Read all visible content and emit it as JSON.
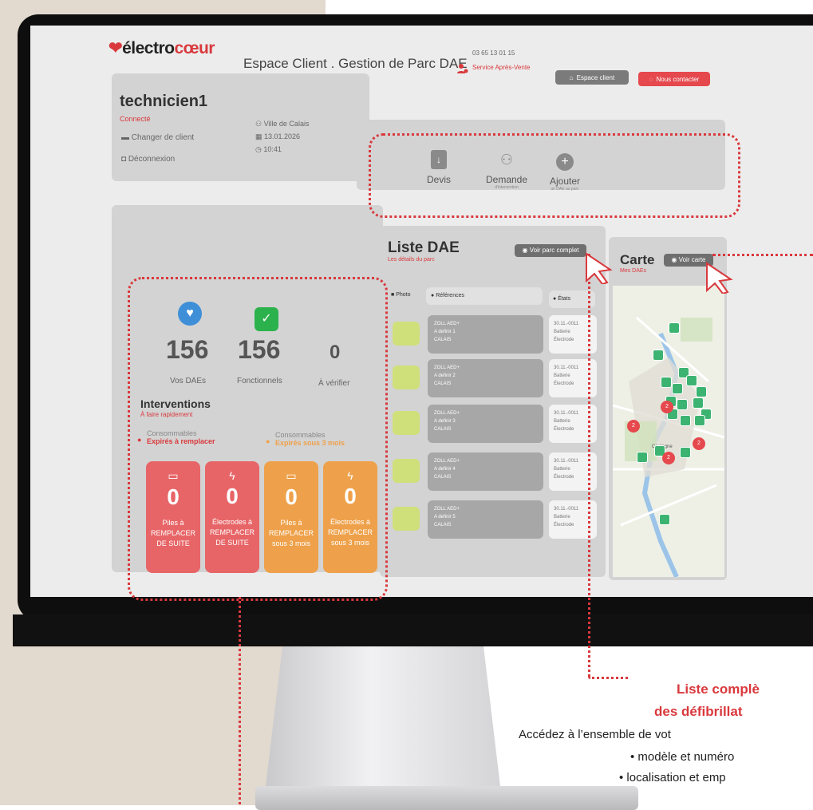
{
  "header": {
    "logo_prefix": "électro",
    "logo_suffix": "cœur",
    "title": "Espace Client . Gestion de Parc DAE",
    "phone": "03 65 13 01 15",
    "service": "Service Après-Vente",
    "espace_client_button": "Espace client",
    "contact_button": "Nous contacter"
  },
  "user": {
    "name": "technicien1",
    "status": "Connecté",
    "change_client": "Changer de client",
    "logout": "Déconnexion",
    "city": "Ville de Calais",
    "date": "13.01.2026",
    "time": "10:41"
  },
  "actions": {
    "devis": "Devis",
    "demande": "Demande",
    "demande_sub": "d'intervention",
    "ajouter": "Ajouter",
    "ajouter_sub": "un DAE au parc"
  },
  "stats": {
    "vos_daes_value": "156",
    "vos_daes_label": "Vos DAEs",
    "fonctionnels_value": "156",
    "fonctionnels_label": "Fonctionnels",
    "a_verifier_value": "0",
    "a_verifier_label": "À vérifier"
  },
  "interventions": {
    "title": "Interventions",
    "subtitle": "À faire rapidement",
    "cons1_label": "Consommables",
    "cons1_sub": "Expirés à remplacer",
    "cons2_label": "Consommables",
    "cons2_sub": "Expirés sous 3 mois",
    "tiles": [
      {
        "value": "0",
        "l1": "Piles à",
        "l2": "REMPLACER",
        "l3": "DE SUITE"
      },
      {
        "value": "0",
        "l1": "Électrodes à",
        "l2": "REMPLACER",
        "l3": "DE SUITE"
      },
      {
        "value": "0",
        "l1": "Piles à",
        "l2": "REMPLACER",
        "l3": "sous 3 mois"
      },
      {
        "value": "0",
        "l1": "Électrodes à",
        "l2": "REMPLACER",
        "l3": "sous 3 mois"
      }
    ]
  },
  "list": {
    "title": "Liste DAE",
    "subtitle": "Les détails du parc",
    "button": "Voir parc complet",
    "col_photo": "Photo",
    "col_refs": "Références",
    "col_states": "États",
    "rows": [
      {
        "model": "ZOLL AED+",
        "ref": "A definir 1",
        "city": "CALAIS",
        "s1": "30.11.-0011",
        "s2": "Batterie",
        "s3": "Électrode"
      },
      {
        "model": "ZOLL AED+",
        "ref": "A definir 2",
        "city": "CALAIS",
        "s1": "30.11.-0011",
        "s2": "Batterie",
        "s3": "Électrode"
      },
      {
        "model": "ZOLL AED+",
        "ref": "A definir 3",
        "city": "CALAIS",
        "s1": "30.11.-0011",
        "s2": "Batterie",
        "s3": "Électrode"
      },
      {
        "model": "ZOLL AED+",
        "ref": "A definir 4",
        "city": "CALAIS",
        "s1": "30.11.-0011",
        "s2": "Batterie",
        "s3": "Électrode"
      },
      {
        "model": "ZOLL AED+",
        "ref": "A definir 5",
        "city": "CALAIS",
        "s1": "30.11.-0011",
        "s2": "Batterie",
        "s3": "Électrode"
      }
    ]
  },
  "map": {
    "title": "Carte",
    "subtitle": "Mes DAEs",
    "button": "Voir carte",
    "cluster_label": "2",
    "place": "Coulogne"
  },
  "callout": {
    "title_line1": "Liste complè",
    "title_line2": "des défibrillat",
    "text_line1": "Accédez à l’ensemble de vot",
    "text_line2": "• modèle et numéro",
    "text_line3": "• localisation et emp"
  },
  "colors": {
    "brand_red": "#d9393d",
    "tile_red": "#e76567",
    "tile_orange": "#eea14a",
    "dae_green": "#3cb371"
  },
  "icons": [
    "heart-icon",
    "clipboard-check-icon",
    "battery-icon",
    "lightning-icon",
    "document-download-icon",
    "people-icon",
    "plus-icon",
    "eye-icon",
    "user-gear-icon",
    "pin-icon",
    "camera-icon"
  ]
}
